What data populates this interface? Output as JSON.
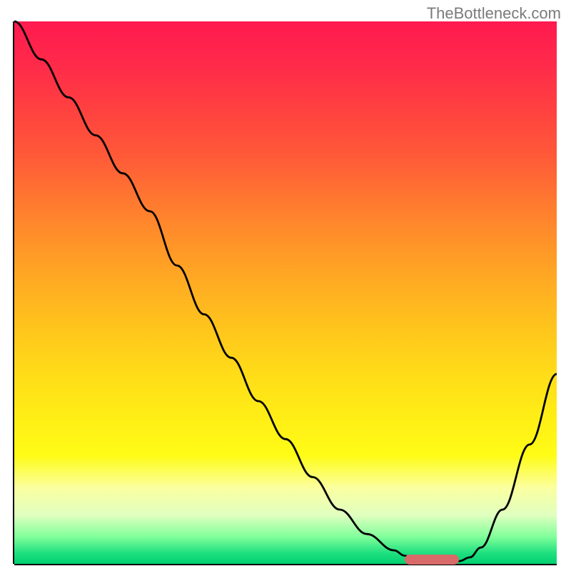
{
  "watermark": "TheBottleneck.com",
  "chart_data": {
    "type": "line",
    "title": "",
    "xlabel": "",
    "ylabel": "",
    "xlim": [
      0,
      100
    ],
    "ylim": [
      0,
      100
    ],
    "grid": false,
    "series": [
      {
        "name": "curve",
        "x": [
          0,
          5,
          10,
          15,
          20,
          25,
          30,
          35,
          40,
          45,
          50,
          55,
          60,
          65,
          70,
          72,
          74,
          76,
          78,
          80,
          82,
          84,
          86,
          90,
          95,
          100
        ],
        "y": [
          100,
          93,
          86,
          79,
          72,
          65,
          55,
          46,
          38,
          30,
          23,
          16,
          10,
          5.5,
          2.5,
          1.5,
          0.8,
          0.4,
          0.2,
          0.2,
          0.5,
          1.2,
          3,
          10,
          22,
          35
        ]
      }
    ],
    "marker": {
      "x_start": 72,
      "x_end": 82,
      "y": 0.2
    },
    "gradient_stops": [
      {
        "pos": 0,
        "color": "#ff1a4f"
      },
      {
        "pos": 25,
        "color": "#ff5a38"
      },
      {
        "pos": 50,
        "color": "#ffae22"
      },
      {
        "pos": 75,
        "color": "#ffee16"
      },
      {
        "pos": 95,
        "color": "#80ff9a"
      },
      {
        "pos": 100,
        "color": "#00d070"
      }
    ]
  }
}
